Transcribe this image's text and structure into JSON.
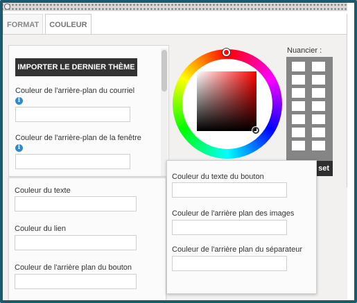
{
  "tabs": [
    {
      "label": "Format",
      "active": false
    },
    {
      "label": "Couleur",
      "active": true
    }
  ],
  "left_panel": {
    "import_button": "Importer le dernier thème",
    "fields": [
      {
        "label": "Couleur de l'arrière-plan du courriel",
        "value": "",
        "has_info": true
      },
      {
        "label": "Couleur de l'arrière-plan de la fenêtre",
        "value": "",
        "has_info": true
      }
    ]
  },
  "lower_panel": {
    "fields": [
      {
        "label": "Couleur du texte",
        "value": ""
      },
      {
        "label": "Couleur du lien",
        "value": ""
      },
      {
        "label": "Couleur de l'arrière plan du bouton",
        "value": ""
      }
    ]
  },
  "overlay_panel": {
    "fields": [
      {
        "label": "Couleur du texte du bouton",
        "value": ""
      },
      {
        "label": "Couleur de l'arrière plan des images",
        "value": ""
      },
      {
        "label": "Couleur de l'arrière plan du séparateur",
        "value": ""
      }
    ]
  },
  "color_picker": {
    "selected_hue": "#ff0000"
  },
  "swatch": {
    "label": "Nuancier :",
    "reset_label": "set",
    "cells_count": 14
  },
  "colors": {
    "frame_border": "#1b5a6e",
    "dark_button": "#333333",
    "info_icon": "#2a8bd0",
    "swatch_bg": "#858585"
  }
}
